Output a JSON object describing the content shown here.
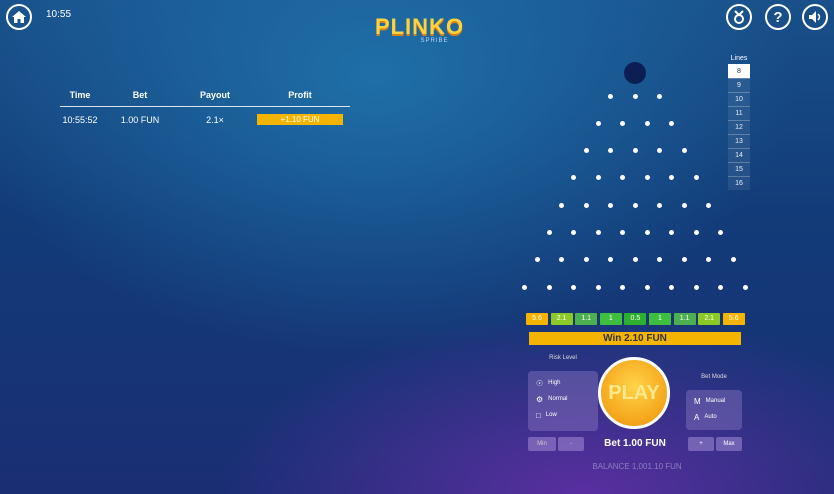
{
  "header": {
    "time": "10:55",
    "logo_title": "PLINKO",
    "logo_sub": "SPRIBE",
    "icons": [
      "home-icon",
      "info-icon",
      "help-icon",
      "sound-icon"
    ]
  },
  "history": {
    "columns": [
      "Time",
      "Bet",
      "Payout",
      "Profit"
    ],
    "rows": [
      {
        "time": "10:55:52",
        "bet": "1.00 FUN",
        "payout": "2.1×",
        "profit": "+1.10 FUN"
      }
    ]
  },
  "lines": {
    "label": "Lines",
    "options": [
      "8",
      "9",
      "10",
      "11",
      "12",
      "13",
      "14",
      "15",
      "16"
    ],
    "selected": "8"
  },
  "board": {
    "multipliers": [
      {
        "label": "5.6",
        "color": "#f5b400"
      },
      {
        "label": "2.1",
        "color": "#8ac926"
      },
      {
        "label": "1.1",
        "color": "#4caf50"
      },
      {
        "label": "1",
        "color": "#3fbf3f"
      },
      {
        "label": "0.5",
        "color": "#2eaf2e"
      },
      {
        "label": "1",
        "color": "#3fbf3f"
      },
      {
        "label": "1.1",
        "color": "#4caf50"
      },
      {
        "label": "2.1",
        "color": "#8ac926"
      },
      {
        "label": "5.6",
        "color": "#f5b400"
      }
    ],
    "win_text": "Win 2.10 FUN"
  },
  "risk": {
    "title": "Risk Level",
    "options": [
      {
        "label": "High",
        "icon": "flame-icon"
      },
      {
        "label": "Normal",
        "icon": "gear-icon"
      },
      {
        "label": "Low",
        "icon": "lock-icon"
      }
    ],
    "min_label": "Min",
    "minus_label": "-"
  },
  "mode": {
    "title": "Bet Mode",
    "options": [
      {
        "label": "Manual",
        "icon": "manual-icon"
      },
      {
        "label": "Auto",
        "icon": "auto-icon"
      }
    ],
    "plus_label": "+",
    "max_label": "Max"
  },
  "play_label": "PLAY",
  "bet_text": "Bet 1.00 FUN",
  "balance_text": "BALANCE 1,001.10 FUN"
}
